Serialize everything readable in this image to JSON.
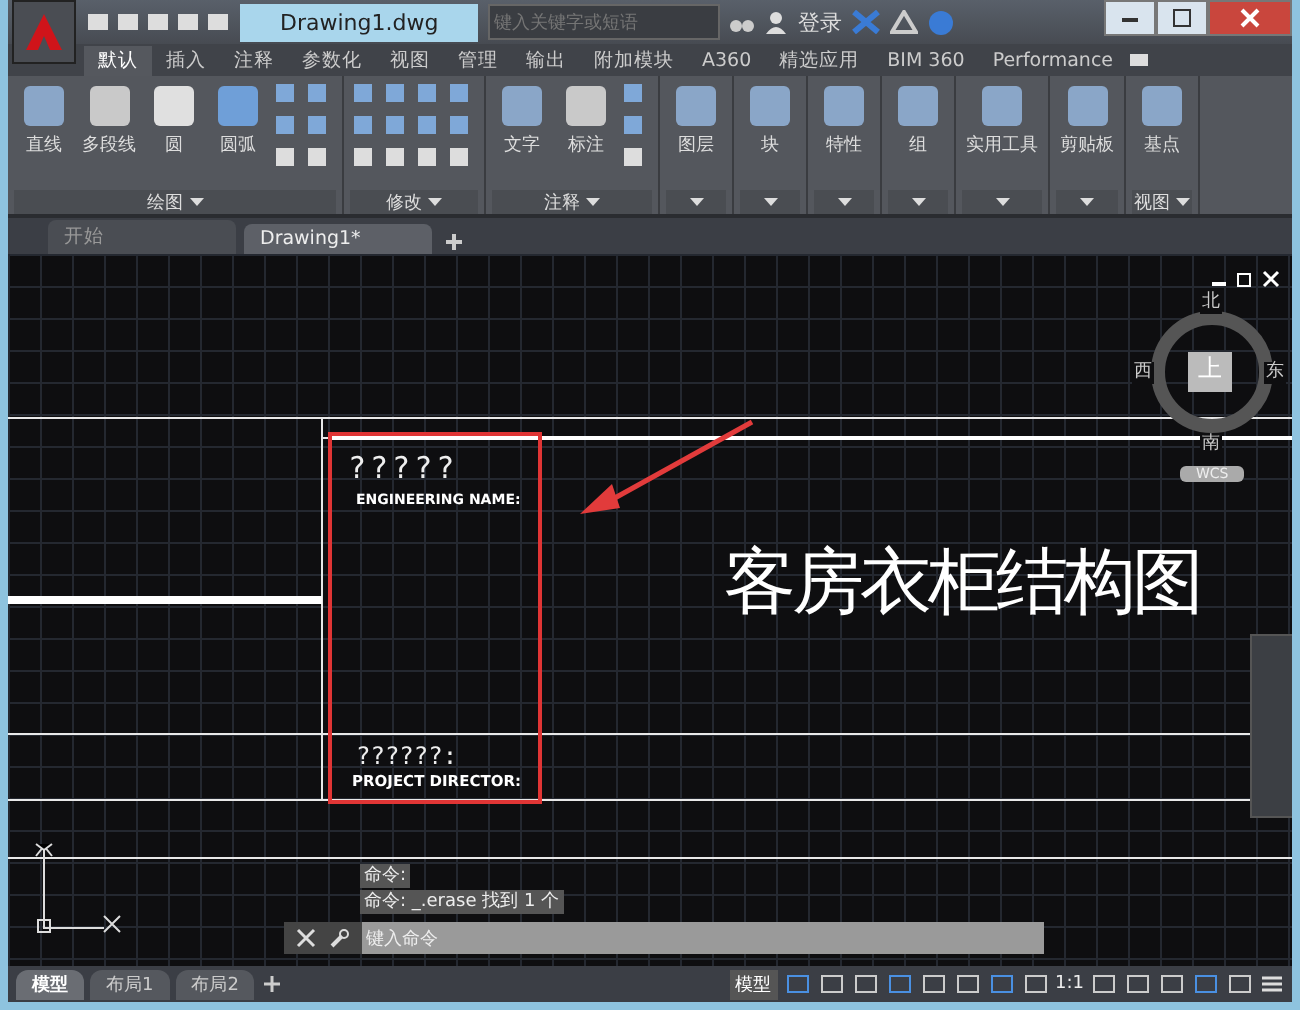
{
  "window": {
    "title": "Drawing1.dwg",
    "search": {
      "placeholder": "键入关键字或短语"
    },
    "login": "登录"
  },
  "ribbon_tabs": [
    {
      "label": "默认",
      "selected": true
    },
    {
      "label": "插入",
      "selected": false
    },
    {
      "label": "注释",
      "selected": false
    },
    {
      "label": "参数化",
      "selected": false
    },
    {
      "label": "视图",
      "selected": false
    },
    {
      "label": "管理",
      "selected": false
    },
    {
      "label": "输出",
      "selected": false
    },
    {
      "label": "附加模块",
      "selected": false
    },
    {
      "label": "A360",
      "selected": false
    },
    {
      "label": "精选应用",
      "selected": false
    },
    {
      "label": "BIM 360",
      "selected": false
    },
    {
      "label": "Performance",
      "selected": false
    }
  ],
  "panels": [
    {
      "title": "绘图",
      "tools": [
        "直线",
        "多段线",
        "圆",
        "圆弧"
      ]
    },
    {
      "title": "修改"
    },
    {
      "title": "注释",
      "tools": [
        "文字",
        "标注"
      ]
    },
    {
      "tools": [
        "图层"
      ]
    },
    {
      "tools": [
        "块"
      ]
    },
    {
      "tools": [
        "特性"
      ]
    },
    {
      "tools": [
        "组"
      ]
    },
    {
      "tools": [
        "实用工具"
      ]
    },
    {
      "tools": [
        "剪贴板"
      ]
    },
    {
      "title": "视图",
      "tools": [
        "基点"
      ]
    }
  ],
  "doc_tabs": [
    {
      "label": "开始",
      "selected": false
    },
    {
      "label": "Drawing1*",
      "selected": true
    }
  ],
  "drawing": {
    "title_text": "?????",
    "engineering_label": "ENGINEERING NAME:",
    "heading": "客房衣柜结构图",
    "director_title": "??????:",
    "director_label": "PROJECT DIRECTOR:"
  },
  "viewcube": {
    "north": "北",
    "west": "西",
    "top": "上",
    "east": "东",
    "south": "南",
    "ucs": "WCS"
  },
  "command": {
    "history": [
      "命令:",
      "命令: _.erase 找到 1 个"
    ],
    "placeholder": "键入命令"
  },
  "layout_tabs": [
    {
      "label": "模型",
      "selected": true
    },
    {
      "label": "布局1",
      "selected": false
    },
    {
      "label": "布局2",
      "selected": false
    }
  ],
  "status_bar": {
    "model": "模型",
    "scale": "1:1"
  }
}
